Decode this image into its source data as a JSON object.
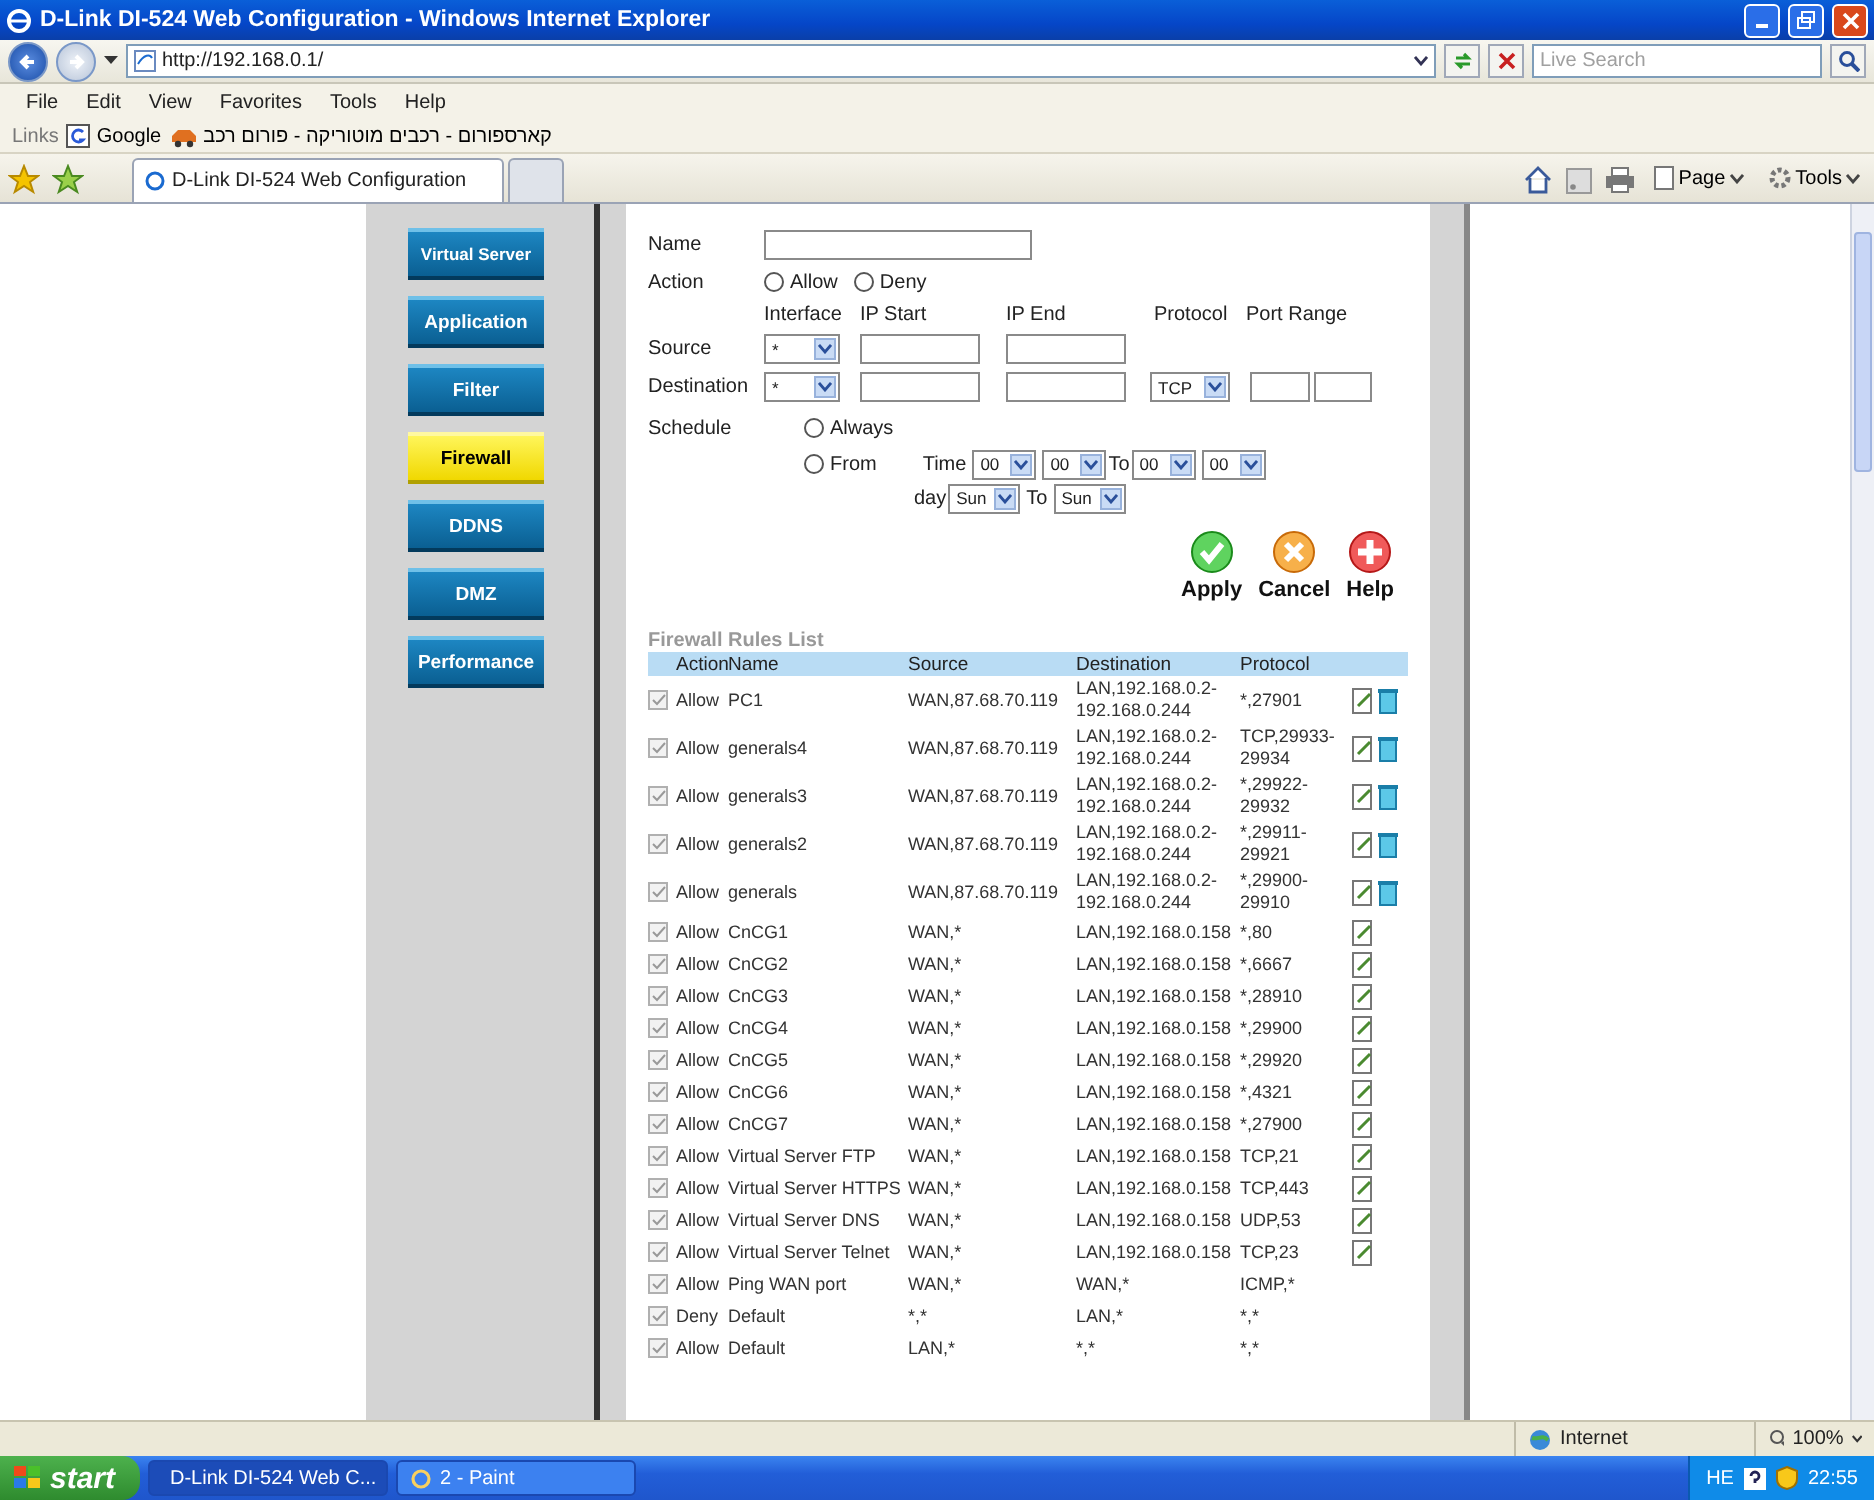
{
  "window": {
    "title": "D-Link DI-524 Web Configuration - Windows Internet Explorer"
  },
  "address_bar": {
    "value": "http://192.168.0.1/"
  },
  "search": {
    "placeholder": "Live Search"
  },
  "menu": [
    "File",
    "Edit",
    "View",
    "Favorites",
    "Tools",
    "Help"
  ],
  "links_bar": {
    "label": "Links",
    "items": [
      {
        "kind": "google",
        "label": "Google"
      },
      {
        "kind": "car",
        "label": "קארספורום - רכבים מוטוריקה - פורום רכב"
      }
    ]
  },
  "tabs": [
    {
      "label": "D-Link DI-524 Web Configuration",
      "selected": true
    }
  ],
  "command_bar": [
    "Page",
    "Tools"
  ],
  "sidebar": [
    {
      "label": "Virtual Server",
      "selected": false
    },
    {
      "label": "Application",
      "selected": false
    },
    {
      "label": "Filter",
      "selected": false
    },
    {
      "label": "Firewall",
      "selected": true
    },
    {
      "label": "DDNS",
      "selected": false
    },
    {
      "label": "DMZ",
      "selected": false
    },
    {
      "label": "Performance",
      "selected": false
    }
  ],
  "form": {
    "name_label": "Name",
    "action_label": "Action",
    "action_options": [
      {
        "label": "Allow",
        "selected": false
      },
      {
        "label": "Deny",
        "selected": false
      }
    ],
    "columns": [
      "Interface",
      "IP Start",
      "IP End",
      "Protocol",
      "Port Range"
    ],
    "source": {
      "label": "Source",
      "interface": "*"
    },
    "destination": {
      "label": "Destination",
      "interface": "*",
      "protocol": "TCP"
    },
    "schedule": {
      "label": "Schedule",
      "options": [
        {
          "label": "Always",
          "selected": false
        },
        {
          "label": "From",
          "selected": false
        }
      ],
      "time_label": "Time",
      "start_hour": "00",
      "start_minute": "00",
      "to_label": "To",
      "end_hour": "00",
      "end_minute": "00",
      "day_label": "day",
      "start_day": "Sun",
      "day_to_label": "To",
      "end_day": "Sun"
    }
  },
  "buttons": [
    {
      "kind": "apply",
      "label": "Apply"
    },
    {
      "kind": "cancel",
      "label": "Cancel"
    },
    {
      "kind": "help",
      "label": "Help"
    }
  ],
  "rules": {
    "title": "Firewall Rules List",
    "columns": [
      "Action",
      "Name",
      "Source",
      "Destination",
      "Protocol"
    ],
    "rows": [
      {
        "checked": true,
        "action": "Allow",
        "name": "PC1",
        "source": "WAN,87.68.70.119",
        "destination": "LAN,192.168.0.2-192.168.0.244",
        "protocol": "*,27901",
        "editable": true,
        "deletable": true
      },
      {
        "checked": true,
        "action": "Allow",
        "name": "generals4",
        "source": "WAN,87.68.70.119",
        "destination": "LAN,192.168.0.2-192.168.0.244",
        "protocol": "TCP,29933-29934",
        "editable": true,
        "deletable": true
      },
      {
        "checked": true,
        "action": "Allow",
        "name": "generals3",
        "source": "WAN,87.68.70.119",
        "destination": "LAN,192.168.0.2-192.168.0.244",
        "protocol": "*,29922-29932",
        "editable": true,
        "deletable": true
      },
      {
        "checked": true,
        "action": "Allow",
        "name": "generals2",
        "source": "WAN,87.68.70.119",
        "destination": "LAN,192.168.0.2-192.168.0.244",
        "protocol": "*,29911-29921",
        "editable": true,
        "deletable": true
      },
      {
        "checked": true,
        "action": "Allow",
        "name": "generals",
        "source": "WAN,87.68.70.119",
        "destination": "LAN,192.168.0.2-192.168.0.244",
        "protocol": "*,29900-29910",
        "editable": true,
        "deletable": true
      },
      {
        "checked": true,
        "action": "Allow",
        "name": "CnCG1",
        "source": "WAN,*",
        "destination": "LAN,192.168.0.158",
        "protocol": "*,80",
        "editable": true,
        "deletable": false
      },
      {
        "checked": true,
        "action": "Allow",
        "name": "CnCG2",
        "source": "WAN,*",
        "destination": "LAN,192.168.0.158",
        "protocol": "*,6667",
        "editable": true,
        "deletable": false
      },
      {
        "checked": true,
        "action": "Allow",
        "name": "CnCG3",
        "source": "WAN,*",
        "destination": "LAN,192.168.0.158",
        "protocol": "*,28910",
        "editable": true,
        "deletable": false
      },
      {
        "checked": true,
        "action": "Allow",
        "name": "CnCG4",
        "source": "WAN,*",
        "destination": "LAN,192.168.0.158",
        "protocol": "*,29900",
        "editable": true,
        "deletable": false
      },
      {
        "checked": true,
        "action": "Allow",
        "name": "CnCG5",
        "source": "WAN,*",
        "destination": "LAN,192.168.0.158",
        "protocol": "*,29920",
        "editable": true,
        "deletable": false
      },
      {
        "checked": true,
        "action": "Allow",
        "name": "CnCG6",
        "source": "WAN,*",
        "destination": "LAN,192.168.0.158",
        "protocol": "*,4321",
        "editable": true,
        "deletable": false
      },
      {
        "checked": true,
        "action": "Allow",
        "name": "CnCG7",
        "source": "WAN,*",
        "destination": "LAN,192.168.0.158",
        "protocol": "*,27900",
        "editable": true,
        "deletable": false
      },
      {
        "checked": true,
        "action": "Allow",
        "name": "Virtual Server FTP",
        "source": "WAN,*",
        "destination": "LAN,192.168.0.158",
        "protocol": "TCP,21",
        "editable": true,
        "deletable": false
      },
      {
        "checked": true,
        "action": "Allow",
        "name": "Virtual Server HTTPS",
        "source": "WAN,*",
        "destination": "LAN,192.168.0.158",
        "protocol": "TCP,443",
        "editable": true,
        "deletable": false
      },
      {
        "checked": true,
        "action": "Allow",
        "name": "Virtual Server DNS",
        "source": "WAN,*",
        "destination": "LAN,192.168.0.158",
        "protocol": "UDP,53",
        "editable": true,
        "deletable": false
      },
      {
        "checked": true,
        "action": "Allow",
        "name": "Virtual Server Telnet",
        "source": "WAN,*",
        "destination": "LAN,192.168.0.158",
        "protocol": "TCP,23",
        "editable": true,
        "deletable": false
      },
      {
        "checked": true,
        "action": "Allow",
        "name": "Ping WAN port",
        "source": "WAN,*",
        "destination": "WAN,*",
        "protocol": "ICMP,*",
        "editable": false,
        "deletable": false
      },
      {
        "checked": true,
        "action": "Deny",
        "name": "Default",
        "source": "*,*",
        "destination": "LAN,*",
        "protocol": "*,*",
        "editable": false,
        "deletable": false
      },
      {
        "checked": true,
        "action": "Allow",
        "name": "Default",
        "source": "LAN,*",
        "destination": "*,*",
        "protocol": "*,*",
        "editable": false,
        "deletable": false
      }
    ]
  },
  "status_bar": {
    "zone": "Internet",
    "zoom": "100%"
  },
  "taskbar": {
    "start": "start",
    "tasks": [
      {
        "label": "D-Link DI-524 Web C...",
        "selected": true
      },
      {
        "label": "2 - Paint",
        "selected": false
      }
    ],
    "language": "HE",
    "clock": "22:55"
  }
}
